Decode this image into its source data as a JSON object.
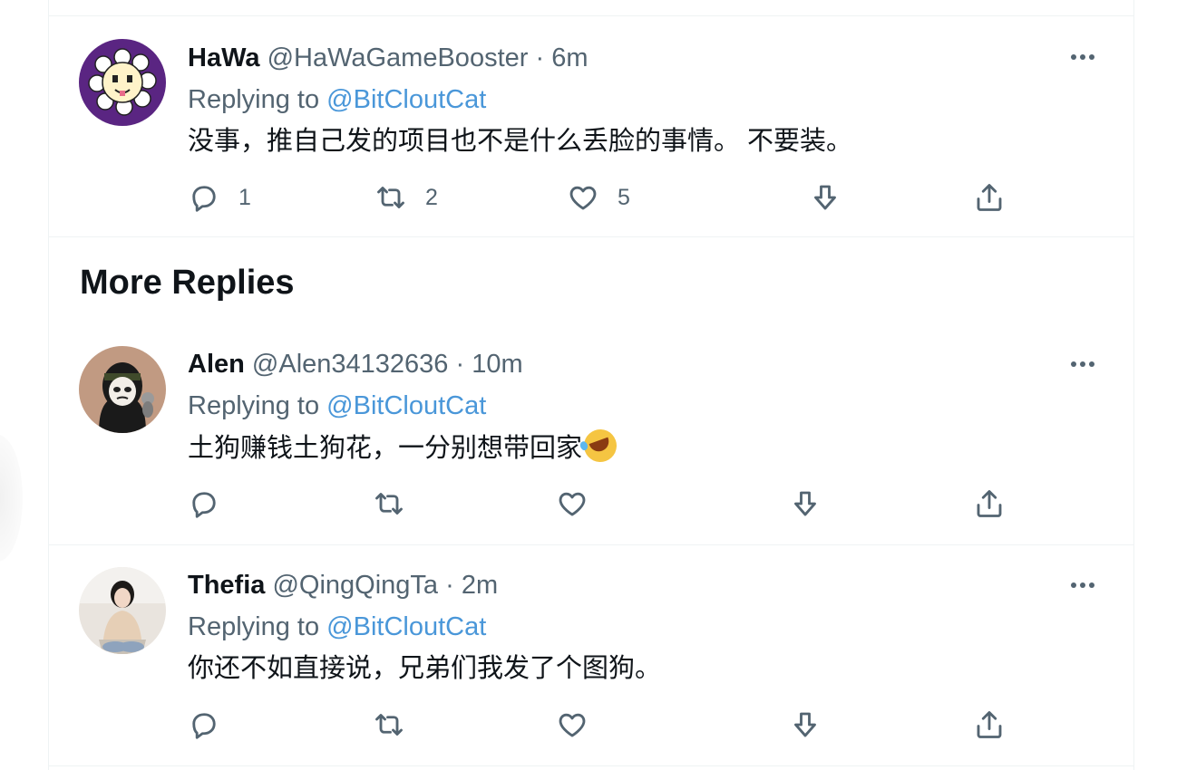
{
  "section_title": "More Replies",
  "tweets": [
    {
      "name": "HaWa",
      "handle": "@HaWaGameBooster",
      "separator": "·",
      "time": "6m",
      "replying_prefix": "Replying to ",
      "replying_to": "@BitCloutCat",
      "body": "没事，推自己发的项目也不是什么丢脸的事情。 不要装。",
      "counts": {
        "reply": "1",
        "retweet": "2",
        "like": "5"
      },
      "avatar_bg": "#5a2582"
    },
    {
      "name": "Alen",
      "handle": "@Alen34132636",
      "separator": "·",
      "time": "10m",
      "replying_prefix": "Replying to ",
      "replying_to": "@BitCloutCat",
      "body": "土狗赚钱土狗花，一分别想带回家",
      "emoji": "rolling-on-floor-laughing",
      "counts": {
        "reply": "",
        "retweet": "",
        "like": ""
      },
      "avatar_bg": "#c19a82"
    },
    {
      "name": "Thefia",
      "handle": "@QingQingTa",
      "separator": "·",
      "time": "2m",
      "replying_prefix": "Replying to ",
      "replying_to": "@BitCloutCat",
      "body": "你还不如直接说，兄弟们我发了个图狗。",
      "counts": {
        "reply": "",
        "retweet": "",
        "like": ""
      },
      "avatar_bg": "#e9e4de"
    }
  ],
  "icons": {
    "more": "more-horizontal-icon",
    "reply": "reply-icon",
    "retweet": "retweet-icon",
    "like": "heart-icon",
    "downvote": "downvote-icon",
    "share": "share-icon"
  },
  "colors": {
    "accent": "#4a97d9",
    "muted": "#536471",
    "text": "#0f1419",
    "border": "#eff3f4"
  }
}
